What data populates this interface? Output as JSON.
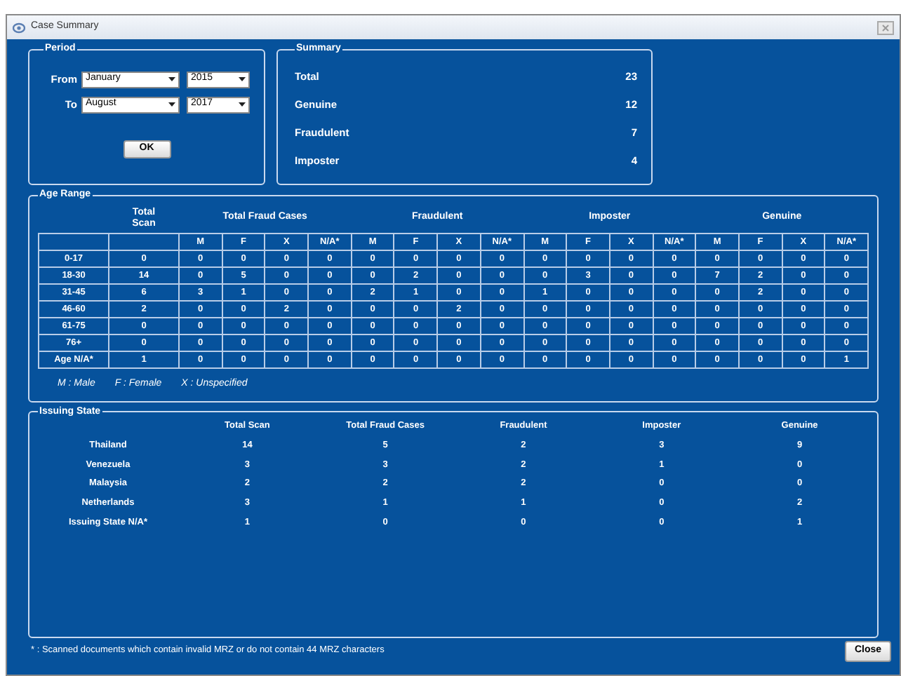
{
  "window": {
    "title": "Case Summary"
  },
  "period": {
    "title": "Period",
    "rows": [
      {
        "label": "From",
        "month": "January",
        "year": "2015"
      },
      {
        "label": "To",
        "month": "August",
        "year": "2017"
      }
    ],
    "button": "OK"
  },
  "summary": {
    "title": "Summary",
    "items": [
      {
        "label": "Total",
        "value": "23"
      },
      {
        "label": "Genuine",
        "value": "12"
      },
      {
        "label": "Fraudulent",
        "value": "7"
      },
      {
        "label": "Imposter",
        "value": "4"
      }
    ]
  },
  "age_range": {
    "title": "Age Range",
    "group_headers": [
      "Total Scan",
      "Total Fraud Cases",
      "Fraudulent",
      "Imposter",
      "Genuine"
    ],
    "sub_headers": [
      "M",
      "F",
      "X",
      "N/A*",
      "M",
      "F",
      "X",
      "N/A*",
      "M",
      "F",
      "X",
      "N/A*",
      "M",
      "F",
      "X",
      "N/A*"
    ],
    "rows": [
      {
        "label": "0-17",
        "cells": [
          "0",
          "0",
          "0",
          "0",
          "0",
          "0",
          "0",
          "0",
          "0",
          "0",
          "0",
          "0",
          "0",
          "0",
          "0",
          "0",
          "0"
        ]
      },
      {
        "label": "18-30",
        "cells": [
          "14",
          "0",
          "5",
          "0",
          "0",
          "0",
          "2",
          "0",
          "0",
          "0",
          "3",
          "0",
          "0",
          "7",
          "2",
          "0",
          "0"
        ]
      },
      {
        "label": "31-45",
        "cells": [
          "6",
          "3",
          "1",
          "0",
          "0",
          "2",
          "1",
          "0",
          "0",
          "1",
          "0",
          "0",
          "0",
          "0",
          "2",
          "0",
          "0"
        ]
      },
      {
        "label": "46-60",
        "cells": [
          "2",
          "0",
          "0",
          "2",
          "0",
          "0",
          "0",
          "2",
          "0",
          "0",
          "0",
          "0",
          "0",
          "0",
          "0",
          "0",
          "0"
        ]
      },
      {
        "label": "61-75",
        "cells": [
          "0",
          "0",
          "0",
          "0",
          "0",
          "0",
          "0",
          "0",
          "0",
          "0",
          "0",
          "0",
          "0",
          "0",
          "0",
          "0",
          "0"
        ]
      },
      {
        "label": "76+",
        "cells": [
          "0",
          "0",
          "0",
          "0",
          "0",
          "0",
          "0",
          "0",
          "0",
          "0",
          "0",
          "0",
          "0",
          "0",
          "0",
          "0",
          "0"
        ]
      },
      {
        "label": "Age N/A*",
        "cells": [
          "1",
          "0",
          "0",
          "0",
          "0",
          "0",
          "0",
          "0",
          "0",
          "0",
          "0",
          "0",
          "0",
          "0",
          "0",
          "0",
          "1"
        ]
      }
    ],
    "legend": [
      "M : Male",
      "F : Female",
      "X : Unspecified"
    ]
  },
  "issuing_state": {
    "title": "Issuing State",
    "columns": [
      "Total Scan",
      "Total Fraud Cases",
      "Fraudulent",
      "Imposter",
      "Genuine"
    ],
    "rows": [
      {
        "label": "Thailand",
        "cells": [
          "14",
          "5",
          "2",
          "3",
          "9"
        ]
      },
      {
        "label": "Venezuela",
        "cells": [
          "3",
          "3",
          "2",
          "1",
          "0"
        ]
      },
      {
        "label": "Malaysia",
        "cells": [
          "2",
          "2",
          "2",
          "0",
          "0"
        ]
      },
      {
        "label": "Netherlands",
        "cells": [
          "3",
          "1",
          "1",
          "0",
          "2"
        ]
      },
      {
        "label": "Issuing State N/A*",
        "cells": [
          "1",
          "0",
          "0",
          "0",
          "1"
        ]
      }
    ]
  },
  "footnote": "* : Scanned documents which contain invalid MRZ or do not contain 44 MRZ characters",
  "close_button": "Close"
}
